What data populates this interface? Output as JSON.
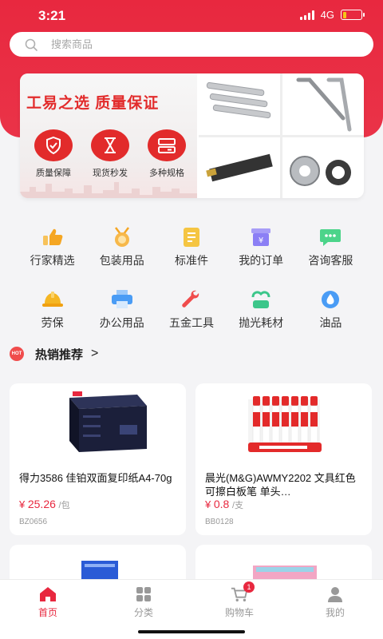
{
  "status": {
    "time": "3:21",
    "network": "4G",
    "battery_level": 0.2
  },
  "search": {
    "placeholder": "搜索商品"
  },
  "banner": {
    "slogan": "工易之选  质量保证",
    "features": [
      {
        "label": "质量保障",
        "icon": "shield-check-icon"
      },
      {
        "label": "现货秒发",
        "icon": "hourglass-icon"
      },
      {
        "label": "多种规格",
        "icon": "specs-icon"
      }
    ]
  },
  "quick_menu": [
    {
      "label": "行家精选",
      "icon": "thumbs-up-icon",
      "color": "#f5a623"
    },
    {
      "label": "包装用品",
      "icon": "medal-icon",
      "color": "#f5a623"
    },
    {
      "label": "标准件",
      "icon": "document-icon",
      "color": "#f5c542"
    },
    {
      "label": "我的订单",
      "icon": "order-box-icon",
      "color": "#8b7ff5"
    },
    {
      "label": "咨询客服",
      "icon": "chat-icon",
      "color": "#4cd48a"
    },
    {
      "label": "劳保",
      "icon": "hard-hat-icon",
      "color": "#f5b623"
    },
    {
      "label": "办公用品",
      "icon": "printer-icon",
      "color": "#4a9cf5"
    },
    {
      "label": "五金工具",
      "icon": "wrench-icon",
      "color": "#f04c4c"
    },
    {
      "label": "抛光耗材",
      "icon": "polish-icon",
      "color": "#3cc68a"
    },
    {
      "label": "油品",
      "icon": "oil-drop-icon",
      "color": "#4a9cf5"
    }
  ],
  "hot_section": {
    "badge": "HOT",
    "title": "热销推荐",
    "arrow": ">"
  },
  "products": [
    {
      "name": "得力3586 佳铂双面复印纸A4-70g",
      "currency": "¥",
      "price": "25.26",
      "unit": "/包",
      "code": "BZ0656"
    },
    {
      "name": "晨光(M&G)AWMY2202 文具红色可擦白板笔 单头…",
      "currency": "¥",
      "price": "0.8",
      "unit": "/支",
      "code": "BB0128"
    }
  ],
  "tabs": [
    {
      "label": "首页",
      "icon": "home-icon",
      "active": true
    },
    {
      "label": "分类",
      "icon": "grid-icon",
      "active": false
    },
    {
      "label": "购物车",
      "icon": "cart-icon",
      "active": false,
      "badge": "1"
    },
    {
      "label": "我的",
      "icon": "user-icon",
      "active": false
    }
  ],
  "colors": {
    "brand_red": "#e8283f",
    "text_dark": "#222222",
    "muted": "#999999"
  }
}
